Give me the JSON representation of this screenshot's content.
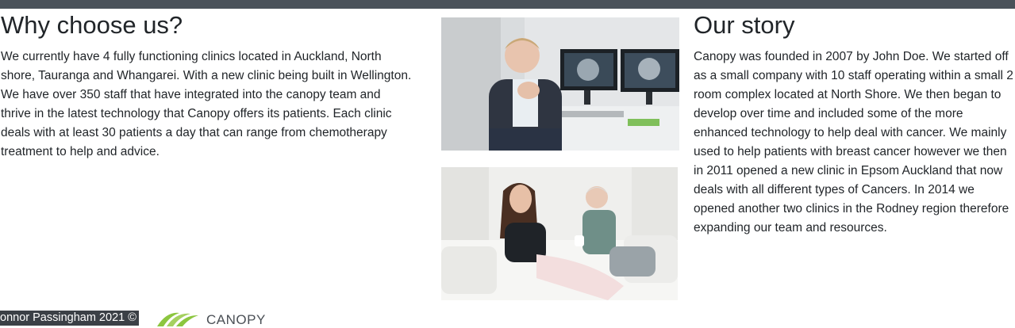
{
  "why": {
    "title": "Why choose us?",
    "body": "We currently have 4 fully functioning clinics located in Auckland, North shore, Tauranga and Whangarei. With a new clinic being built in Wellington. We have over 350 staff that have integrated into the canopy team and thrive in the latest technology that Canopy offers its patients. Each clinic deals with at least 30 patients a day that can range from chemotherapy treatment to help and advice."
  },
  "story": {
    "title": "Our story",
    "body": "Canopy was founded in 2007 by John Doe. We started off as a small company with 10 staff operating within a small 2 room complex located at North Shore. We then began to develop over time and included some of the more enhanced technology to help deal with cancer. We mainly used to help patients with breast cancer however we then in 2011 opened a new clinic in Epsom Auckland that now deals with all different types of Cancers. In 2014 we opened another two clinics in the Rodney region therefore expanding our team and resources."
  },
  "footer": {
    "copyright": "onnor Passingham 2021 ©",
    "logo_text": "CANOPY"
  },
  "colors": {
    "topbar": "#4a525a",
    "footer_bg": "#3b4046",
    "logo_green": "#8cc63f"
  }
}
